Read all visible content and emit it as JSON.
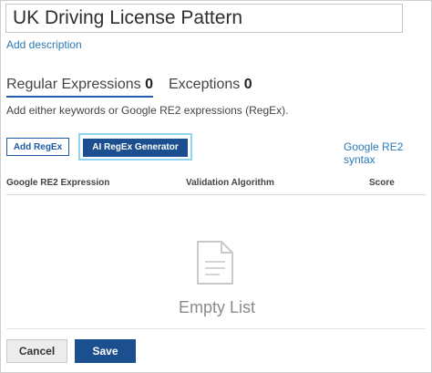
{
  "pattern": {
    "name_value": "UK Driving License Pattern",
    "add_description": "Add description"
  },
  "tabs": [
    {
      "label": "Regular Expressions",
      "count": "0",
      "active": true
    },
    {
      "label": "Exceptions",
      "count": "0",
      "active": false
    }
  ],
  "hint": "Add either keywords or Google RE2 expressions (RegEx).",
  "actions": {
    "add_regex": "Add RegEx",
    "ai_generator": "AI RegEx Generator",
    "syntax_link": "Google RE2 syntax"
  },
  "table": {
    "columns": [
      "Google RE2 Expression",
      "Validation Algorithm",
      "Score"
    ],
    "empty_text": "Empty List"
  },
  "footer": {
    "cancel": "Cancel",
    "save": "Save"
  },
  "colors": {
    "primary": "#1b4f8f",
    "link": "#2a7ab8",
    "highlight": "#8fd3f0"
  },
  "icons": {
    "empty_state": "document-icon"
  }
}
